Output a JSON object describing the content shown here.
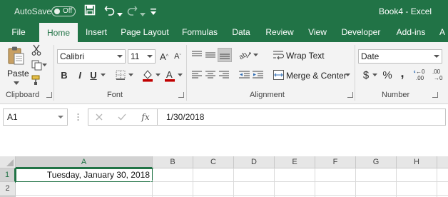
{
  "titlebar": {
    "autosave_label": "AutoSave",
    "autosave_state": "Off",
    "document_title": "Book4  -  Excel",
    "accent_color": "#217346"
  },
  "quick_access": [
    "save-icon",
    "undo-icon",
    "redo-icon",
    "customize-qat-icon"
  ],
  "tabs": [
    "File",
    "Home",
    "Insert",
    "Page Layout",
    "Formulas",
    "Data",
    "Review",
    "View",
    "Developer",
    "Add-ins",
    "A"
  ],
  "active_tab": "Home",
  "ribbon": {
    "clipboard": {
      "label": "Clipboard",
      "paste_label": "Paste"
    },
    "font": {
      "label": "Font",
      "font_name": "Calibri",
      "font_size": "11",
      "bold": "B",
      "italic": "I",
      "underline": "U"
    },
    "alignment": {
      "label": "Alignment",
      "wrap_text": "Wrap Text",
      "merge_center": "Merge & Center"
    },
    "number": {
      "label": "Number",
      "format": "Date",
      "currency": "$",
      "percent": "%",
      "comma": ","
    }
  },
  "formula_bar": {
    "name_box": "A1",
    "fx_label": "fx",
    "formula": "1/30/2018"
  },
  "sheet": {
    "columns": [
      "A",
      "B",
      "C",
      "D",
      "E",
      "F",
      "G",
      "H"
    ],
    "rows": [
      "1",
      "2",
      "3"
    ],
    "selected_column": "A",
    "selected_row": "1",
    "cells": {
      "A1": "Tuesday, January 30, 2018"
    }
  }
}
